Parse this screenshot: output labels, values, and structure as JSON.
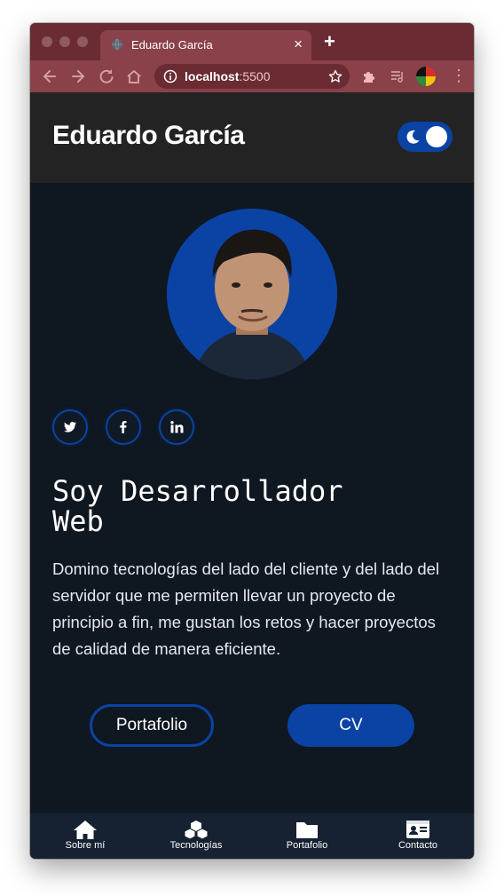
{
  "browser": {
    "tab_title": "Eduardo García",
    "url_host": "localhost",
    "url_port": ":5500"
  },
  "header": {
    "brand": "Eduardo García",
    "theme_toggle": "dark"
  },
  "hero": {
    "social": [
      "twitter",
      "facebook",
      "linkedin"
    ],
    "headline_line1": "Soy Desarrollador",
    "headline_line2": "Web",
    "bio": "Domino tecnologías del lado del cliente y del lado del servidor que me permiten llevar un proyecto de principio a fin, me gustan los retos y hacer proyectos de calidad de manera eficiente.",
    "btn_portfolio": "Portafolio",
    "btn_cv": "CV"
  },
  "bottom_nav": {
    "about": "Sobre mí",
    "tech": "Tecnologías",
    "portfolio": "Portafolio",
    "contact": "Contacto"
  },
  "colors": {
    "accent": "#0a43a3",
    "page_bg": "#0f1720",
    "header_bg": "#232323",
    "browser_frame": "#8a4149"
  }
}
